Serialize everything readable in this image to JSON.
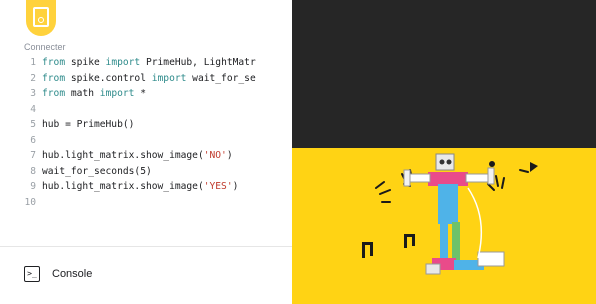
{
  "editor": {
    "connection_label": "Connecter",
    "lines": [
      {
        "num": "1",
        "parts": [
          {
            "t": "from",
            "k": "kw"
          },
          {
            "t": " spike ",
            "k": ""
          },
          {
            "t": "import",
            "k": "kw"
          },
          {
            "t": " PrimeHub, LightMatr",
            "k": ""
          }
        ]
      },
      {
        "num": "2",
        "parts": [
          {
            "t": "from",
            "k": "kw"
          },
          {
            "t": " spike.control ",
            "k": ""
          },
          {
            "t": "import",
            "k": "kw"
          },
          {
            "t": " wait_for_se",
            "k": ""
          }
        ]
      },
      {
        "num": "3",
        "parts": [
          {
            "t": "from",
            "k": "kw"
          },
          {
            "t": " math ",
            "k": ""
          },
          {
            "t": "import",
            "k": "kw"
          },
          {
            "t": " *",
            "k": ""
          }
        ]
      },
      {
        "num": "4",
        "parts": []
      },
      {
        "num": "5",
        "parts": [
          {
            "t": "hub = PrimeHub()",
            "k": ""
          }
        ]
      },
      {
        "num": "6",
        "parts": []
      },
      {
        "num": "7",
        "parts": [
          {
            "t": "hub.light_matrix.show_image(",
            "k": ""
          },
          {
            "t": "'NO'",
            "k": "str"
          },
          {
            "t": ")",
            "k": ""
          }
        ]
      },
      {
        "num": "8",
        "parts": [
          {
            "t": "wait_for_seconds(5)",
            "k": ""
          }
        ]
      },
      {
        "num": "9",
        "parts": [
          {
            "t": "hub.light_matrix.show_image(",
            "k": ""
          },
          {
            "t": "'YES'",
            "k": "str"
          },
          {
            "t": ")",
            "k": ""
          }
        ]
      },
      {
        "num": "10",
        "parts": []
      }
    ]
  },
  "console": {
    "label": "Console",
    "icon": "console-icon"
  },
  "hub_icon": "hub-icon",
  "colors": {
    "hub_yellow": "#ffd23c",
    "video_dark": "#262626",
    "video_yellow": "#ffd314",
    "keyword": "#2e8b8b",
    "string": "#c0392b"
  }
}
